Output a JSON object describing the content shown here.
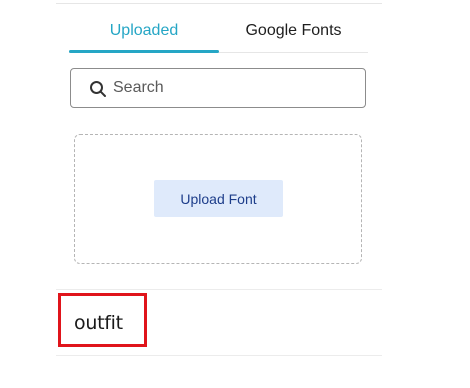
{
  "tabs": [
    {
      "label": "Uploaded",
      "active": true
    },
    {
      "label": "Google Fonts",
      "active": false
    }
  ],
  "search": {
    "placeholder": "Search",
    "value": "",
    "icon": "search-icon"
  },
  "dropzone": {
    "upload_label": "Upload Font"
  },
  "fonts": [
    {
      "name": "outfit",
      "highlighted": true
    }
  ],
  "colors": {
    "accent": "#25a6c5",
    "upload_button_bg": "#dfeafb",
    "upload_button_text": "#1d3d8a",
    "highlight": "#e0141b"
  }
}
